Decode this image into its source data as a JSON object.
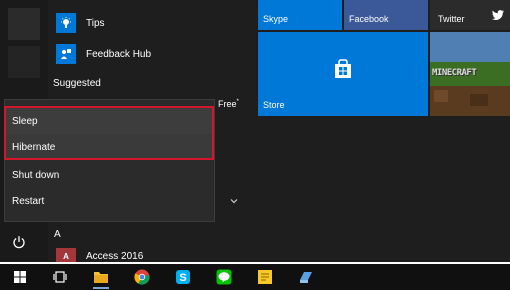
{
  "app_list": {
    "items": [
      {
        "label": "Tips",
        "icon": "lightbulb-icon"
      },
      {
        "label": "Feedback Hub",
        "icon": "feedback-hub-icon"
      }
    ],
    "suggested_heading": "Suggested",
    "suggested_fragment": "Free",
    "suggested_fragment_sup": "*",
    "section_letter": "A",
    "access_label": "Access 2016",
    "access_icon_text": "A"
  },
  "power_menu": {
    "items": [
      {
        "label": "Sleep"
      },
      {
        "label": "Hibernate"
      },
      {
        "label": "Shut down"
      },
      {
        "label": "Restart"
      }
    ],
    "highlight_color": "#d5152b"
  },
  "tiles": {
    "skype": "Skype",
    "facebook": "Facebook",
    "twitter": "Twitter",
    "store": "Store",
    "minecraft_logo": "MINECRAFT"
  },
  "taskbar": {
    "icons": [
      "windows-start-icon",
      "task-view-icon",
      "file-explorer-icon",
      "chrome-icon",
      "skype-icon",
      "line-icon",
      "sticky-notes-icon",
      "app-icon"
    ]
  },
  "colors": {
    "accent": "#0078d7",
    "facebook": "#3b5998",
    "menu_bg": "#1e1e1e",
    "taskbar_bg": "#101010"
  }
}
